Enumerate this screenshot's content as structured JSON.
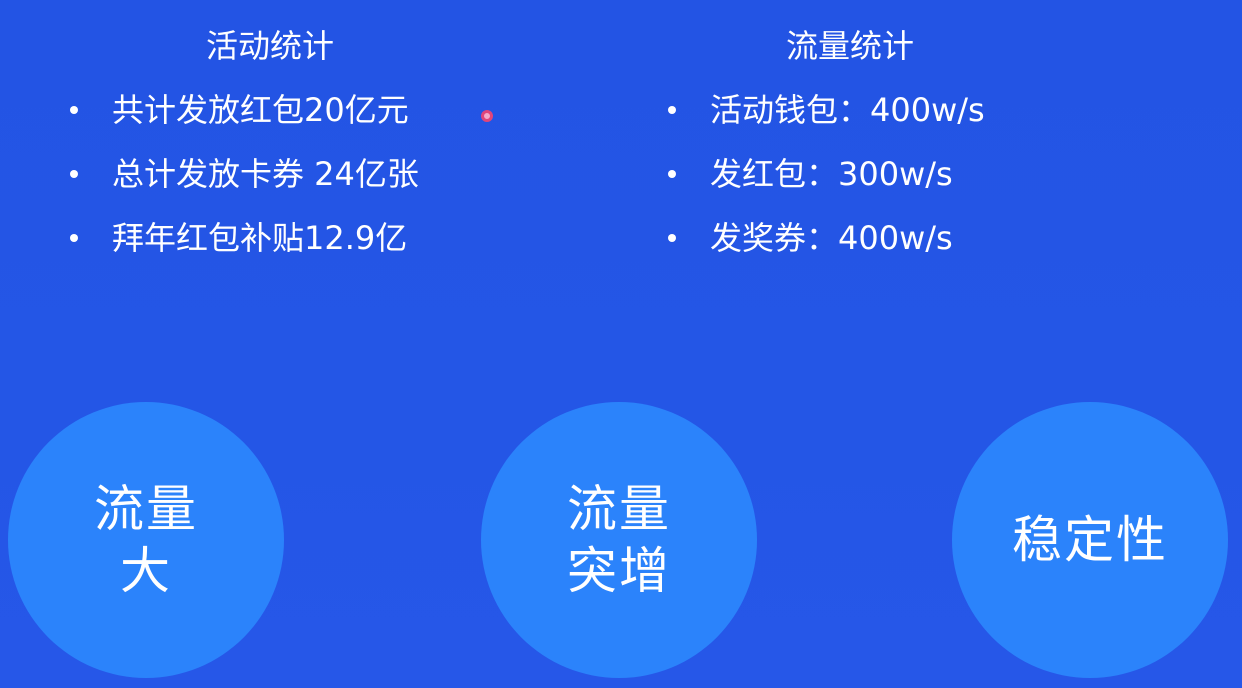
{
  "activity_stats": {
    "title": "活动统计",
    "items": [
      "共计发放红包20亿元",
      "总计发放卡券 24亿张",
      "拜年红包补贴12.9亿"
    ]
  },
  "traffic_stats": {
    "title": "流量统计",
    "items": [
      "活动钱包：400w/s",
      "发红包：300w/s",
      "发奖券：400w/s"
    ]
  },
  "circles": [
    {
      "line1": "流量",
      "line2": "大"
    },
    {
      "line1": "流量",
      "line2": "突增"
    },
    {
      "line1": "稳定性",
      "line2": ""
    }
  ],
  "colors": {
    "background": "#2456e6",
    "circle_fill": "#2b83fb",
    "text": "#ffffff",
    "cursor": "#e0457b"
  }
}
